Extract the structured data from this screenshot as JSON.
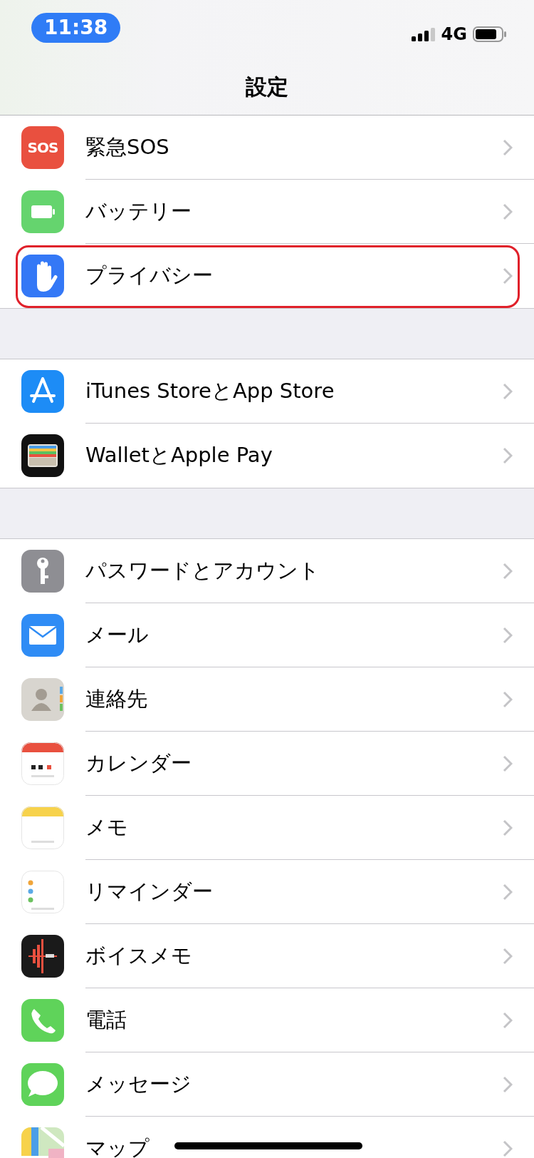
{
  "status_bar": {
    "time": "11:38",
    "network": "4G"
  },
  "nav": {
    "title": "設定"
  },
  "groups": [
    {
      "items": [
        {
          "label": "緊急SOS",
          "icon_text": "SOS",
          "highlighted": false
        },
        {
          "label": "バッテリー",
          "highlighted": false
        },
        {
          "label": "プライバシー",
          "highlighted": true
        }
      ]
    },
    {
      "items": [
        {
          "label": "iTunes StoreとApp Store",
          "highlighted": false
        },
        {
          "label": "WalletとApple Pay",
          "highlighted": false
        }
      ]
    },
    {
      "items": [
        {
          "label": "パスワードとアカウント",
          "highlighted": false
        },
        {
          "label": "メール",
          "highlighted": false
        },
        {
          "label": "連絡先",
          "highlighted": false
        },
        {
          "label": "カレンダー",
          "highlighted": false
        },
        {
          "label": "メモ",
          "highlighted": false
        },
        {
          "label": "リマインダー",
          "highlighted": false
        },
        {
          "label": "ボイスメモ",
          "highlighted": false
        },
        {
          "label": "電話",
          "highlighted": false
        },
        {
          "label": "メッセージ",
          "highlighted": false
        },
        {
          "label": "マップ",
          "highlighted": false
        }
      ]
    }
  ]
}
